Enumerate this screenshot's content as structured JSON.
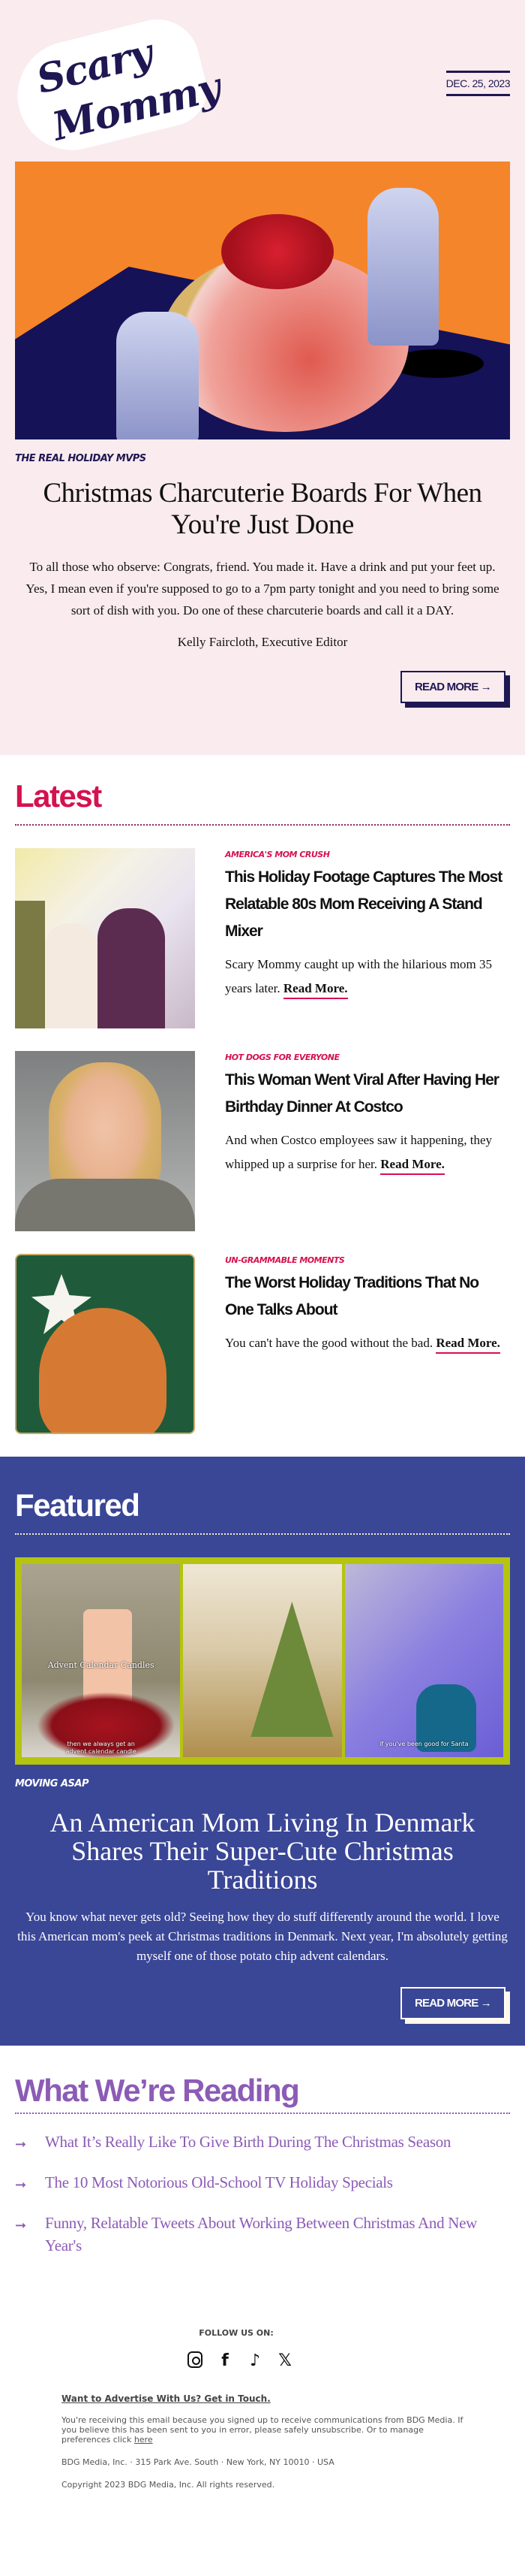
{
  "header": {
    "logo_line1": "Scary",
    "logo_line2": "Mommy",
    "date": "DEC. 25, 2023"
  },
  "hero": {
    "image_alt": "Charcuterie board with red bow and doll hands",
    "kicker": "THE REAL HOLIDAY MVPS",
    "title": "Christmas Charcuterie Boards For When You're Just Done",
    "body": "To all those who observe: Congrats, friend. You made it. Have a drink and put your feet up. Yes, I mean even if you're supposed to go to a 7pm party tonight and you need to bring some sort of dish with you. Do one of these charcuterie boards and call it a DAY.",
    "byline": "Kelly Faircloth, Executive Editor",
    "button_label": "READ MORE →"
  },
  "latest": {
    "title": "Latest",
    "articles": [
      {
        "kicker": "AMERICA'S MOM CRUSH",
        "title": "This Holiday Footage Captures The Most Relatable 80s Mom Receiving A Stand Mixer",
        "summary": "Scary Mommy caught up with the hilarious mom 35 years later.",
        "read_more": "Read More."
      },
      {
        "kicker": "HOT DOGS FOR EVERYONE",
        "title": "This Woman Went Viral After Having Her Birthday Dinner At Costco",
        "summary": "And when Costco employees saw it happening, they whipped up a surprise for her.",
        "read_more": "Read More."
      },
      {
        "kicker": "UN-GRAMMABLE MOMENTS",
        "title": "The Worst Holiday Traditions That No One Talks About",
        "summary": "You can't have the good without the bad.",
        "read_more": "Read More."
      }
    ]
  },
  "featured": {
    "title": "Featured",
    "collage_captions": {
      "panel1_title": "Advent Calendar Candles",
      "panel1_caption": "then we always get an advent calendar candle",
      "panel3_caption": "if you've been good for Santa"
    },
    "kicker": "MOVING ASAP",
    "headline": "An American Mom Living In Denmark Shares Their Super-Cute Christmas Traditions",
    "body": "You know what never gets old? Seeing how they do stuff differently around the world. I love this American mom's peek at Christmas traditions in Denmark. Next year, I'm absolutely getting myself one of those potato chip advent calendars.",
    "button_label": "READ MORE →"
  },
  "reading": {
    "title": "What We’re Reading",
    "items": [
      "What It’s Really Like To Give Birth During The Christmas Season",
      "The 10 Most Notorious Old-School TV Holiday Specials",
      "Funny, Relatable Tweets About Working Between Christmas And New Year's"
    ],
    "arrow_glyph": "➞"
  },
  "footer": {
    "follow_label": "FOLLOW US ON:",
    "social": [
      {
        "name": "instagram-icon",
        "glyph": ""
      },
      {
        "name": "facebook-icon",
        "glyph": "f"
      },
      {
        "name": "tiktok-icon",
        "glyph": "♪"
      },
      {
        "name": "x-icon",
        "glyph": "𝕏"
      }
    ],
    "advertise_label": "Want to Advertise With Us? Get in Touch.",
    "notice": "You're receiving this email because you signed up to receive communications from BDG Media. If you believe this has been sent to you in error, please safely unsubscribe. Or to manage preferences click",
    "notice_link": "here",
    "address": "BDG Media, Inc. · 315 Park Ave. South · New York, NY 10010 · USA",
    "copyright": "Copyright 2023 BDG Media, Inc. All rights reserved."
  },
  "colors": {
    "navy": "#1e1752",
    "pink_bg": "#f9ebee",
    "latest_accent": "#d5114f",
    "featured_bg": "#3a4696",
    "collage_border": "#b5c40f",
    "reading_accent": "#8c5bb6"
  }
}
